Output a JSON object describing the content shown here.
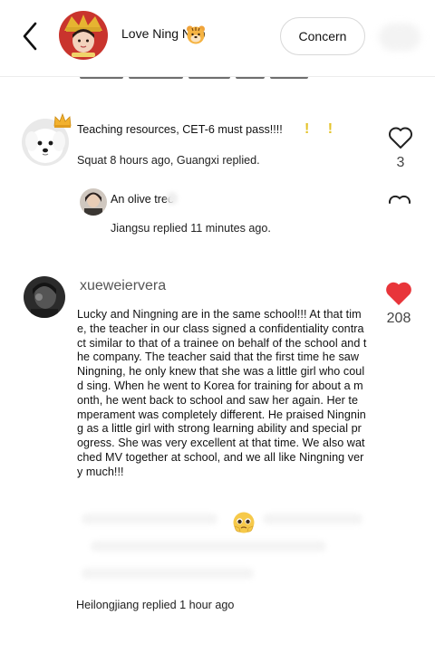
{
  "header": {
    "username": "Love Ning Nao",
    "name_emoji_icon": "tiger-face-emoji",
    "follow_button_label": "Concern",
    "back_icon": "chevron-left-icon"
  },
  "colors": {
    "liked_heart": "#e8353a",
    "unliked_heart": "#222222",
    "button_border": "#d8d8d8",
    "divider": "#ececec"
  },
  "comments": [
    {
      "text": "Teaching resources, CET-6 must pass!!!!",
      "exclamation_emojis": "! !",
      "meta": "Squat 8 hours ago, Guangxi replied.",
      "like_count": "3",
      "liked": false,
      "reply": {
        "username": "An olive tree",
        "meta": "Jiangsu replied 11 minutes ago."
      }
    },
    {
      "username": "xueweiervera",
      "body": "Lucky and Ningning are in the same school!!! At that time, the teacher in our class signed a confidentiality contract similar to that of a trainee on behalf of the school and the company. The teacher said that the first time he saw Ningning, he only knew that she was a little girl who could sing. When he went to Korea for training for about a month, he went back to school and saw her again. Her temperament was completely different. He praised Ningning as a little girl with strong learning ability and special progress. She was very excellent at that time. We also watched MV together at school, and we all like Ningning very much!!!",
      "emoji_icon": "pleading-face-emoji",
      "meta": "Heilongjiang replied 1 hour ago",
      "like_count": "208",
      "liked": true
    }
  ]
}
